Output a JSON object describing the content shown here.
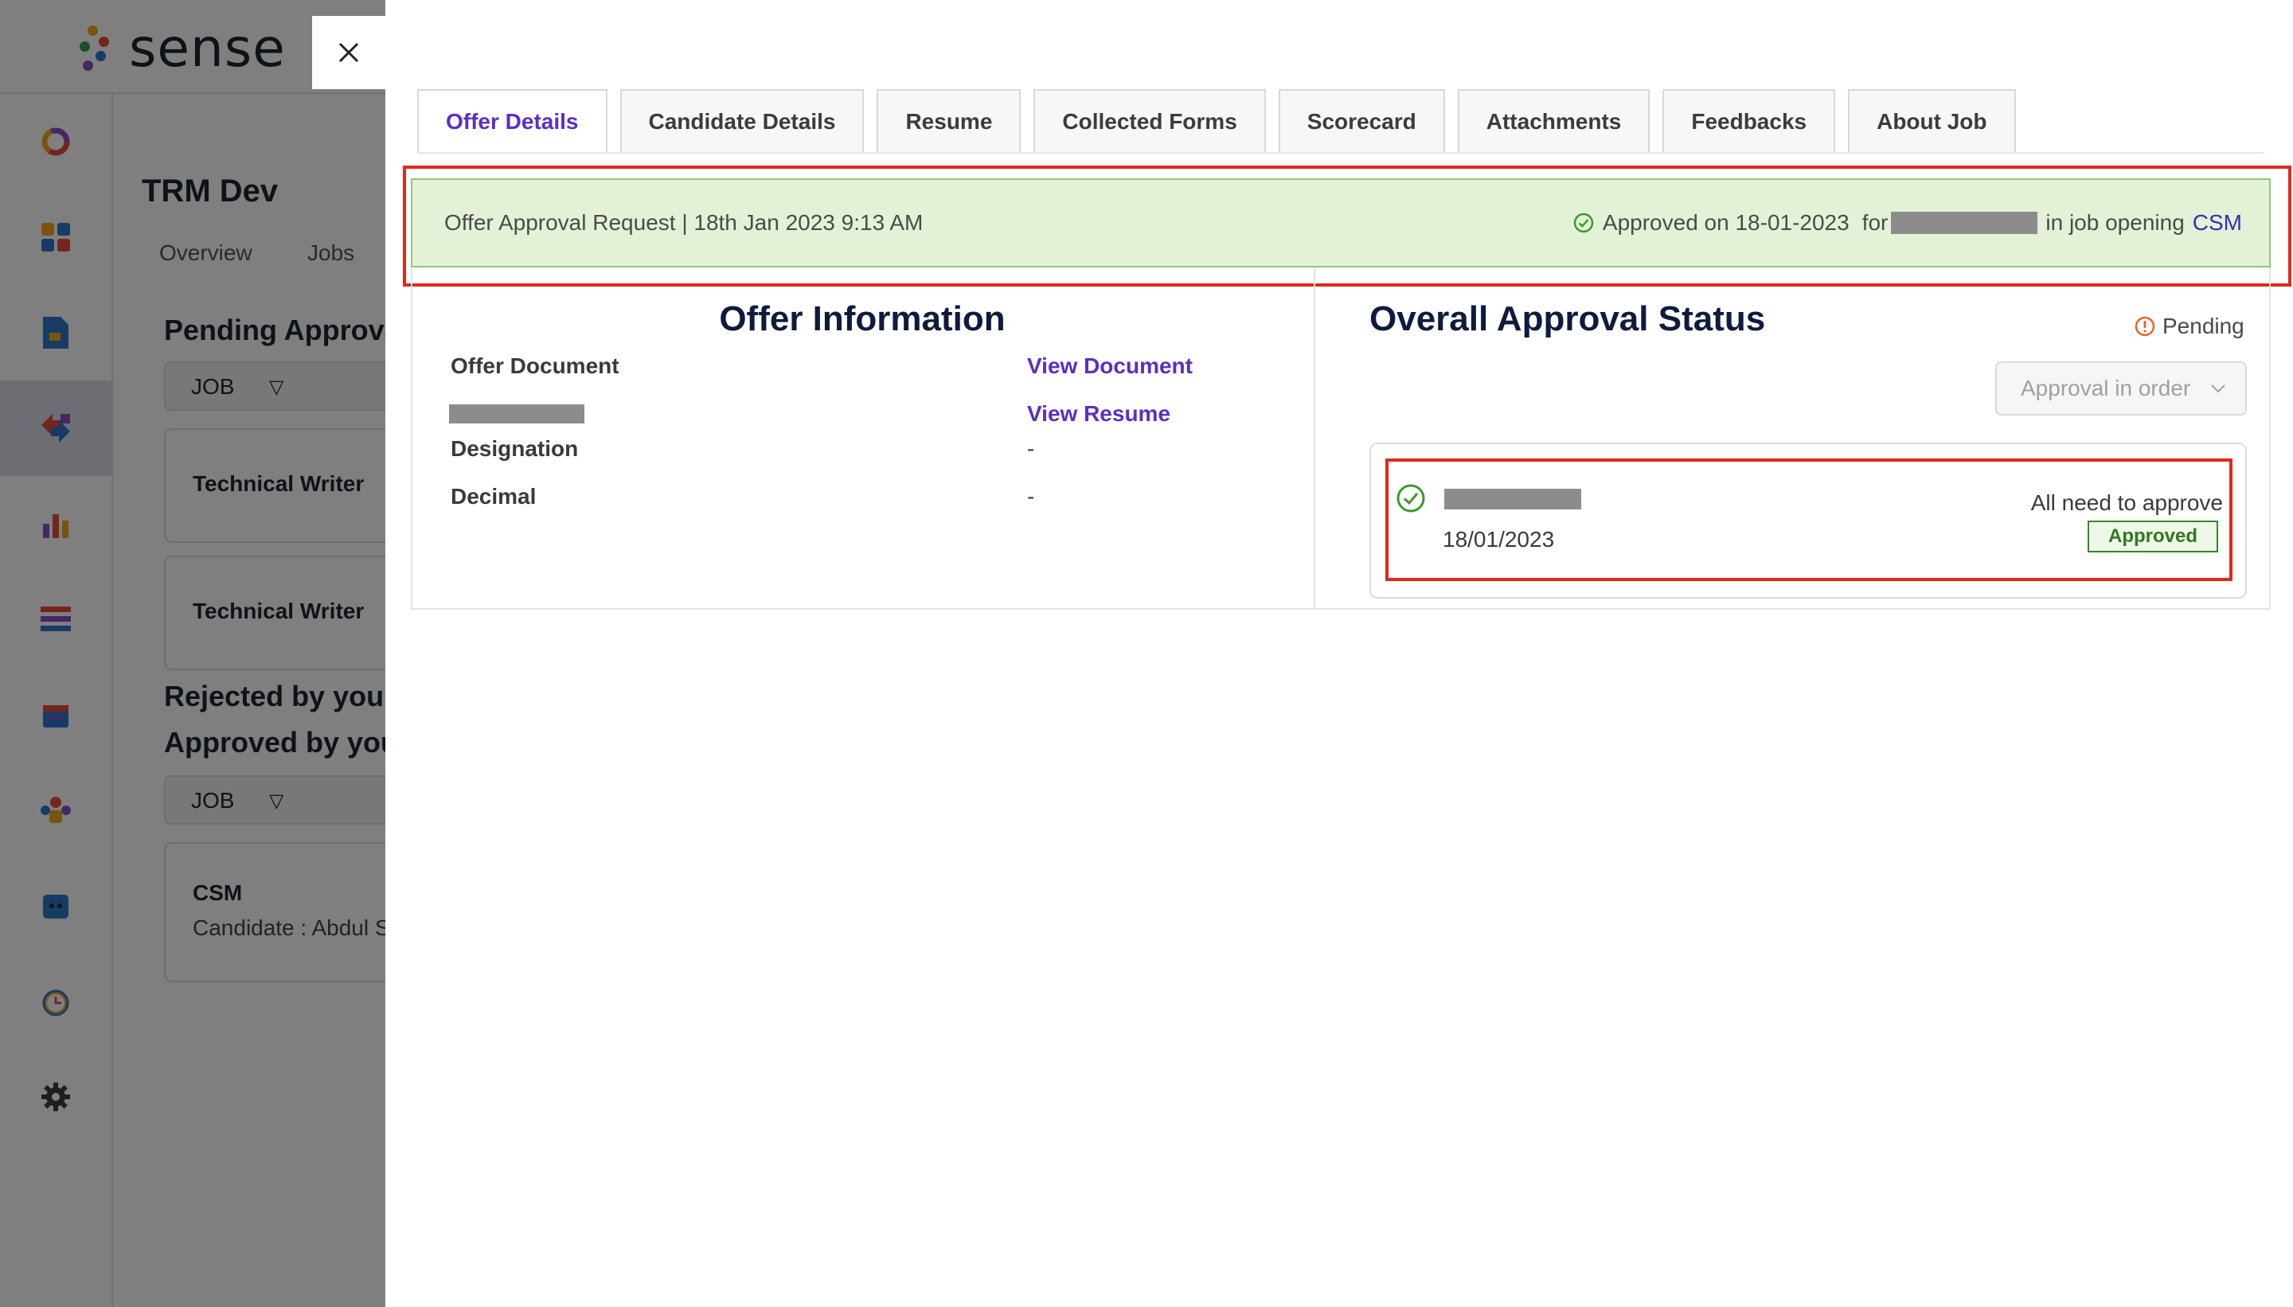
{
  "app": {
    "logo_text": "sense"
  },
  "background": {
    "page_title": "TRM Dev",
    "tabs": [
      "Overview",
      "Jobs"
    ],
    "pending_heading": "Pending Approva",
    "filter_label": "JOB",
    "cards": [
      "Technical Writer",
      "Technical Writer"
    ],
    "rejected_heading": "Rejected by you",
    "approved_heading": "Approved by you",
    "approved_filter_label": "JOB",
    "approved_card": {
      "title": "CSM",
      "candidate": "Candidate : Abdul S"
    }
  },
  "drawer": {
    "tabs": [
      {
        "label": "Offer Details",
        "active": true
      },
      {
        "label": "Candidate Details",
        "active": false
      },
      {
        "label": "Resume",
        "active": false
      },
      {
        "label": "Collected Forms",
        "active": false
      },
      {
        "label": "Scorecard",
        "active": false
      },
      {
        "label": "Attachments",
        "active": false
      },
      {
        "label": "Feedbacks",
        "active": false
      },
      {
        "label": "About Job",
        "active": false
      }
    ],
    "banner": {
      "request_text": "Offer Approval Request | 18th Jan 2023 9:13 AM",
      "approved_text": "Approved on 18-01-2023",
      "for_text": "for",
      "job_opening_text": "in job opening",
      "job_link": "CSM"
    },
    "offer_info": {
      "title": "Offer Information",
      "rows": [
        {
          "label": "Offer Document",
          "value": "View Document"
        },
        {
          "label": "",
          "value": "View Resume"
        },
        {
          "label": "Designation",
          "value": "-"
        },
        {
          "label": "Decimal",
          "value": "-"
        }
      ]
    },
    "approval_status": {
      "title": "Overall Approval Status",
      "status": "Pending",
      "order_select": "Approval in order",
      "approver": {
        "date": "18/01/2023",
        "rule": "All need to approve",
        "badge": "Approved"
      }
    }
  },
  "colors": {
    "accent": "#5a2fc2",
    "banner_bg": "#e3f2d7",
    "highlight": "#e0291b",
    "approved_green": "#2f8a22",
    "pending_orange": "#e8642a"
  }
}
